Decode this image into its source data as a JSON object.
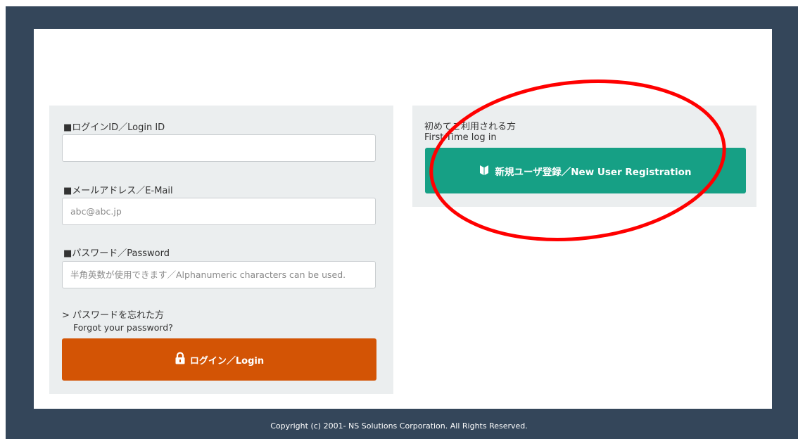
{
  "login_form": {
    "login_id": {
      "label": "■ログインID／Login ID",
      "value": "",
      "placeholder": ""
    },
    "email": {
      "label": "■メールアドレス／E-Mail",
      "value": "",
      "placeholder": "abc@abc.jp"
    },
    "password": {
      "label": "■パスワード／Password",
      "value": "",
      "placeholder": "半角英数が使用できます／Alphanumeric characters can be used."
    },
    "forgot_password": {
      "label_jp": "> パスワードを忘れた方",
      "label_en": "Forgot your password?"
    },
    "login_button": {
      "label": "ログイン／Login",
      "icon": "lock-icon"
    }
  },
  "registration": {
    "heading_jp": "初めてご利用される方",
    "heading_en": "First-Time log in",
    "register_button": {
      "label": "新規ユーザ登録／New User Registration",
      "icon": "beginner-mark-icon"
    }
  },
  "footer": {
    "copyright": "Copyright (c) 2001- NS Solutions Corporation. All Rights Reserved."
  },
  "colors": {
    "frame": "#34465a",
    "panel": "#ebeeef",
    "login_button": "#d35405",
    "register_button": "#16a085",
    "annotation": "#ff0000"
  }
}
